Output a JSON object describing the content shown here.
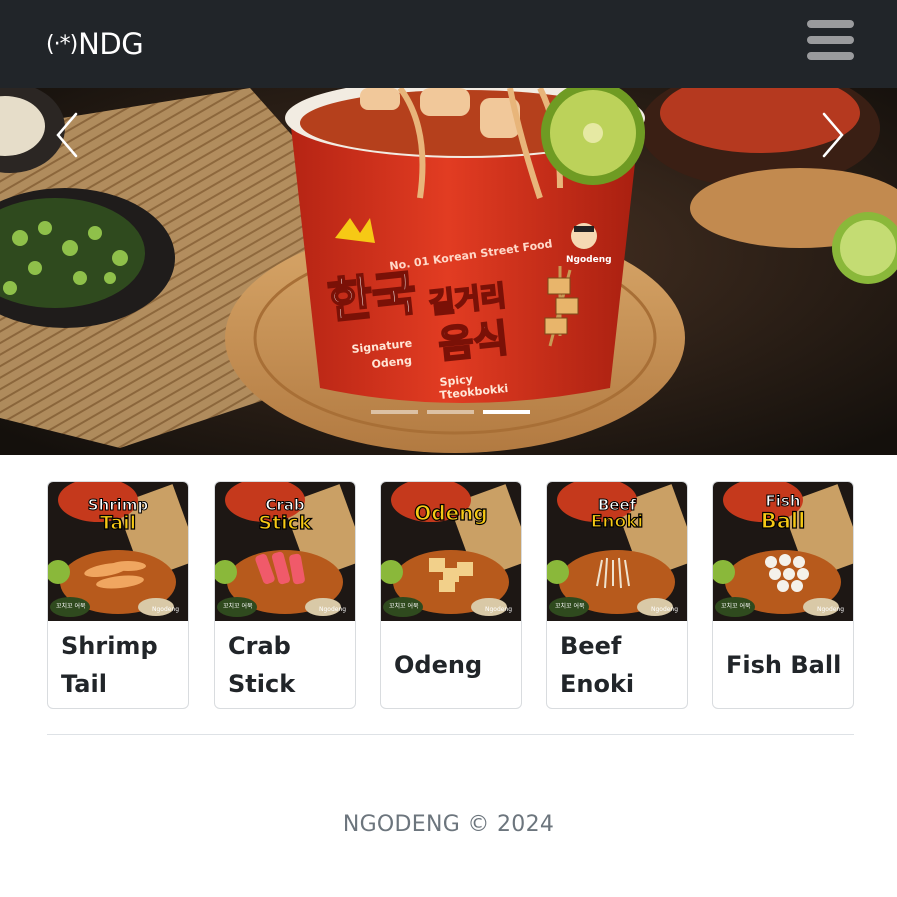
{
  "navbar": {
    "brand_mark": "(·*)",
    "brand_text": "NDG",
    "toggle_icon": "hamburger-icon",
    "background": "#212529"
  },
  "hero": {
    "cup_line1": "No. 01 Korean Street Food",
    "cup_korean_1": "한국",
    "cup_korean_2": "길거리",
    "cup_korean_3": "음식",
    "cup_label_1a": "Signature",
    "cup_label_1b": "Odeng",
    "cup_label_2a": "Spicy",
    "cup_label_2b": "Tteokbokki",
    "cup_mascot": "Ngodeng",
    "prev_icon": "chevron-left-icon",
    "next_icon": "chevron-right-icon",
    "slide_count": 3,
    "active_slide": 3
  },
  "menu": {
    "items": [
      {
        "title": "Shrimp Tail",
        "badge_top": "Shrimp",
        "badge_bottom": "Tail",
        "brand_tag": "Ngodeng",
        "korean_tag": "꼬치꼬 어묵"
      },
      {
        "title": "Crab Stick",
        "badge_top": "Crab",
        "badge_bottom": "Stick",
        "brand_tag": "Ngodeng",
        "korean_tag": "꼬치꼬 어묵"
      },
      {
        "title": "Odeng",
        "badge_top": "",
        "badge_bottom": "Odeng",
        "brand_tag": "Ngodeng",
        "korean_tag": "꼬치꼬 어묵"
      },
      {
        "title": "Beef Enoki",
        "badge_top": "Beef",
        "badge_bottom": "Enoki",
        "brand_tag": "Ngodeng",
        "korean_tag": "꼬치꼬 어묵"
      },
      {
        "title": "Fish Ball",
        "badge_top": "Fish",
        "badge_bottom": "Ball",
        "brand_tag": "Ngodeng",
        "korean_tag": "꼬치꼬 어묵"
      }
    ]
  },
  "footer": {
    "text": "NGODENG © 2024"
  },
  "colors": {
    "accent_yellow": "#f6c915",
    "cup_red": "#d8321c",
    "footer_text": "#6c757d"
  }
}
